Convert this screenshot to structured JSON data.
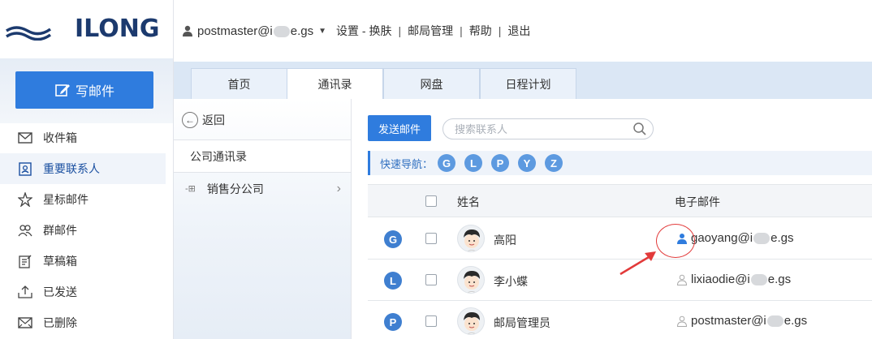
{
  "header": {
    "logo_text": "ILONG",
    "user_label": "postmaster@i",
    "user_suffix": "e.gs",
    "menu": [
      "设置 - 换肤",
      "邮局管理",
      "帮助",
      "退出"
    ]
  },
  "sidebar": {
    "compose_label": "写邮件",
    "items": [
      {
        "label": "收件箱",
        "icon": "envelope-icon"
      },
      {
        "label": "重要联系人",
        "icon": "contact-card-icon"
      },
      {
        "label": "星标邮件",
        "icon": "star-icon"
      },
      {
        "label": "群邮件",
        "icon": "group-icon"
      },
      {
        "label": "草稿箱",
        "icon": "draft-icon"
      },
      {
        "label": "已发送",
        "icon": "sent-icon"
      },
      {
        "label": "已删除",
        "icon": "trash-icon"
      }
    ]
  },
  "tabs": [
    "首页",
    "通讯录",
    "网盘",
    "日程计划"
  ],
  "groups": {
    "back_label": "返回",
    "items": [
      "公司通讯录",
      "销售分公司"
    ]
  },
  "main": {
    "send_label": "发送邮件",
    "search_placeholder": "搜索联系人",
    "quicknav_label": "快速导航：",
    "letters": [
      "G",
      "L",
      "P",
      "Y",
      "Z"
    ],
    "columns": {
      "name": "姓名",
      "email": "电子邮件"
    },
    "rows": [
      {
        "letter": "G",
        "name": "高阳",
        "email_prefix": "gaoyang@i",
        "email_suffix": "e.gs"
      },
      {
        "letter": "L",
        "name": "李小蝶",
        "email_prefix": "lixiaodie@i",
        "email_suffix": "e.gs"
      },
      {
        "letter": "P",
        "name": "邮局管理员",
        "email_prefix": "postmaster@i",
        "email_suffix": "e.gs"
      }
    ]
  },
  "colors": {
    "accent": "#2f7cde",
    "annotation": "#e23a3a"
  }
}
